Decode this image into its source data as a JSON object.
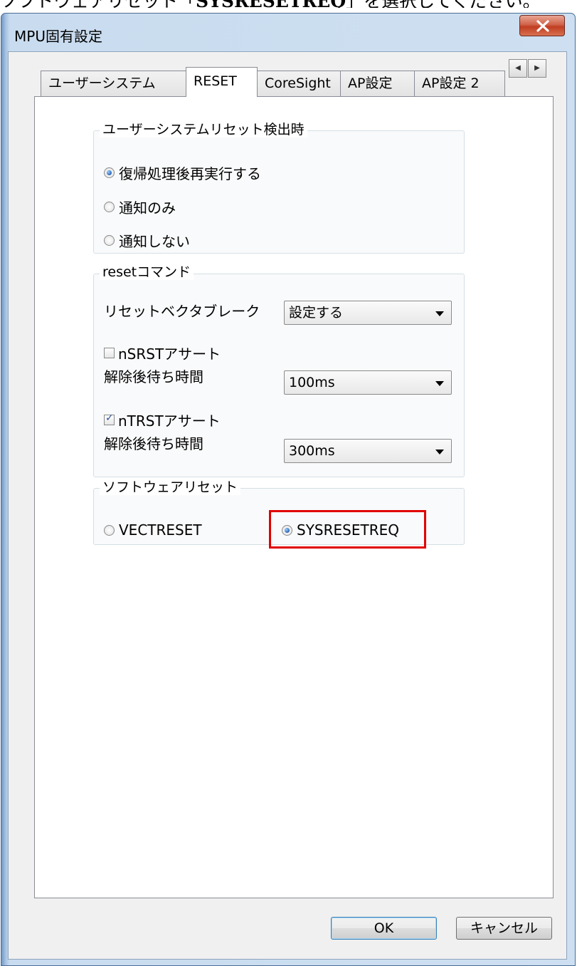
{
  "caption": {
    "before": "ソフトウェアリセット「",
    "bold": "SYSRESETREQ",
    "after": "」を選択してください。"
  },
  "window": {
    "title": "MPU固有設定"
  },
  "tabs": [
    {
      "label": "ユーザーシステム",
      "active": false
    },
    {
      "label": "RESET",
      "active": true
    },
    {
      "label": "CoreSight",
      "active": false
    },
    {
      "label": "AP設定",
      "active": false
    },
    {
      "label": "AP設定 2",
      "active": false
    }
  ],
  "reset_detect": {
    "title": "ユーザーシステムリセット検出時",
    "options": [
      {
        "label": "復帰処理後再実行する",
        "checked": true
      },
      {
        "label": "通知のみ",
        "checked": false
      },
      {
        "label": "通知しない",
        "checked": false
      }
    ]
  },
  "reset_command": {
    "title": "resetコマンド",
    "vector_break_label": "リセットベクタブレーク",
    "vector_break_value": "設定する",
    "nsrst": {
      "label": "nSRSTアサート",
      "checked": false,
      "wait_label": "解除後待ち時間",
      "wait_value": "100ms"
    },
    "ntrst": {
      "label": "nTRSTアサート",
      "checked": true,
      "wait_label": "解除後待ち時間",
      "wait_value": "300ms"
    }
  },
  "software_reset": {
    "title": "ソフトウェアリセット",
    "options": [
      {
        "label": "VECTRESET",
        "checked": false
      },
      {
        "label": "SYSRESETREQ",
        "checked": true
      }
    ]
  },
  "buttons": {
    "ok": "OK",
    "cancel": "キャンセル"
  },
  "colors": {
    "highlight": "#e10000",
    "close_button": "#c13e22",
    "frame": "#cddff0"
  }
}
